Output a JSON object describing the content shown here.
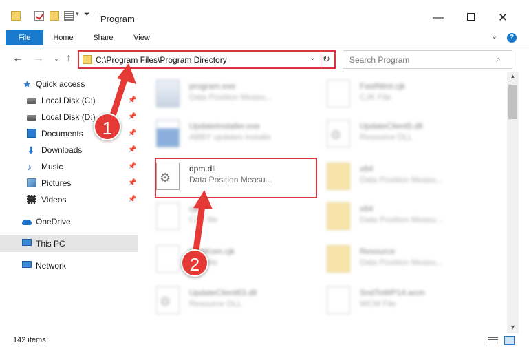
{
  "window": {
    "title": "Program"
  },
  "ribbon": {
    "tabs": [
      "File",
      "Home",
      "Share",
      "View"
    ]
  },
  "address": {
    "path": "C:\\Program Files\\Program Directory"
  },
  "search": {
    "placeholder": "Search Program"
  },
  "sidebar": {
    "items": [
      {
        "label": "Quick access",
        "icon": "quick-access-star-icon",
        "pinned": false
      },
      {
        "label": "Local Disk (C:)",
        "icon": "drive-icon",
        "pinned": true
      },
      {
        "label": "Local Disk (D:)",
        "icon": "drive-icon",
        "pinned": true
      },
      {
        "label": "Documents",
        "icon": "documents-icon",
        "pinned": true
      },
      {
        "label": "Downloads",
        "icon": "downloads-icon",
        "pinned": true
      },
      {
        "label": "Music",
        "icon": "music-icon",
        "pinned": true
      },
      {
        "label": "Pictures",
        "icon": "pictures-icon",
        "pinned": true
      },
      {
        "label": "Videos",
        "icon": "videos-icon",
        "pinned": true
      },
      {
        "label": "OneDrive",
        "icon": "onedrive-icon",
        "pinned": false
      },
      {
        "label": "This PC",
        "icon": "this-pc-icon",
        "pinned": false,
        "selected": true
      },
      {
        "label": "Network",
        "icon": "network-icon",
        "pinned": false
      }
    ]
  },
  "files": [
    {
      "name": "program.exe",
      "desc": "Data Position Measu...",
      "icon": "exe-icon"
    },
    {
      "name": "FastNtml.cjk",
      "desc": "CJK File",
      "icon": "document-icon"
    },
    {
      "name": "UpdateInstaller.exe",
      "desc": "ABBY updates installe",
      "icon": "installer-icon"
    },
    {
      "name": "UpdateClient5.dll",
      "desc": "Resource DLL",
      "icon": "dll-icon"
    },
    {
      "name": "dpm.dll",
      "desc": "Data Position Measu...",
      "icon": "dll-icon",
      "highlighted": true
    },
    {
      "name": "x64",
      "desc": "Data Position Measu...",
      "icon": "folder-icon"
    },
    {
      "name": "cjk",
      "desc": "CJK file",
      "icon": "document-icon"
    },
    {
      "name": "x64",
      "desc": "Data Position Measu...",
      "icon": "folder-icon"
    },
    {
      "name": "FastKom.cjk",
      "desc": "CJK file",
      "icon": "document-icon"
    },
    {
      "name": "Resource",
      "desc": "Data Position Measu...",
      "icon": "folder-icon"
    },
    {
      "name": "UpdateClient63.dll",
      "desc": "Resource DLL",
      "icon": "dll-icon"
    },
    {
      "name": "SndToWP14.wcm",
      "desc": "WCM File",
      "icon": "document-icon"
    }
  ],
  "status": {
    "item_count": "142 items"
  },
  "annotations": {
    "step1": "1",
    "step2": "2"
  },
  "colors": {
    "accent": "#1979ca",
    "highlight": "#d9363e",
    "badge": "#e53935"
  }
}
